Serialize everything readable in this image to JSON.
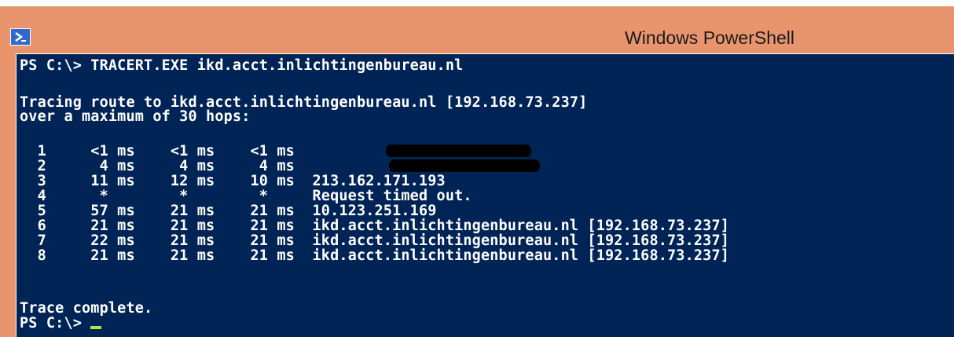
{
  "window": {
    "title": "Windows PowerShell",
    "icon": "powershell-icon",
    "colors": {
      "titlebar": "#E8956E",
      "console_bg": "#012456",
      "console_text": "#FFFFFF",
      "cursor": "#AEE64A"
    }
  },
  "console": {
    "command_line": "PS C:\\> TRACERT.EXE ikd.acct.inlichtingenbureau.nl",
    "tracing_line": "Tracing route to ikd.acct.inlichtingenbureau.nl [192.168.73.237]",
    "hops_line": "over a maximum of 30 hops:",
    "hops": [
      {
        "text": "  1     <1 ms    <1 ms    <1 ms  ",
        "redacted": true
      },
      {
        "text": "  2      4 ms     4 ms     4 ms  ",
        "redacted": true
      },
      {
        "text": "  3     11 ms    12 ms    10 ms  213.162.171.193",
        "redacted": false
      },
      {
        "text": "  4      *        *        *     Request timed out.",
        "redacted": false
      },
      {
        "text": "  5     57 ms    21 ms    21 ms  10.123.251.169",
        "redacted": false
      },
      {
        "text": "  6     21 ms    21 ms    21 ms  ikd.acct.inlichtingenbureau.nl [192.168.73.237]",
        "redacted": false
      },
      {
        "text": "  7     22 ms    21 ms    21 ms  ikd.acct.inlichtingenbureau.nl [192.168.73.237]",
        "redacted": false
      },
      {
        "text": "  8     21 ms    21 ms    21 ms  ikd.acct.inlichtingenbureau.nl [192.168.73.237]",
        "redacted": false
      }
    ],
    "complete_line": "Trace complete.",
    "prompt": "PS C:\\> "
  }
}
